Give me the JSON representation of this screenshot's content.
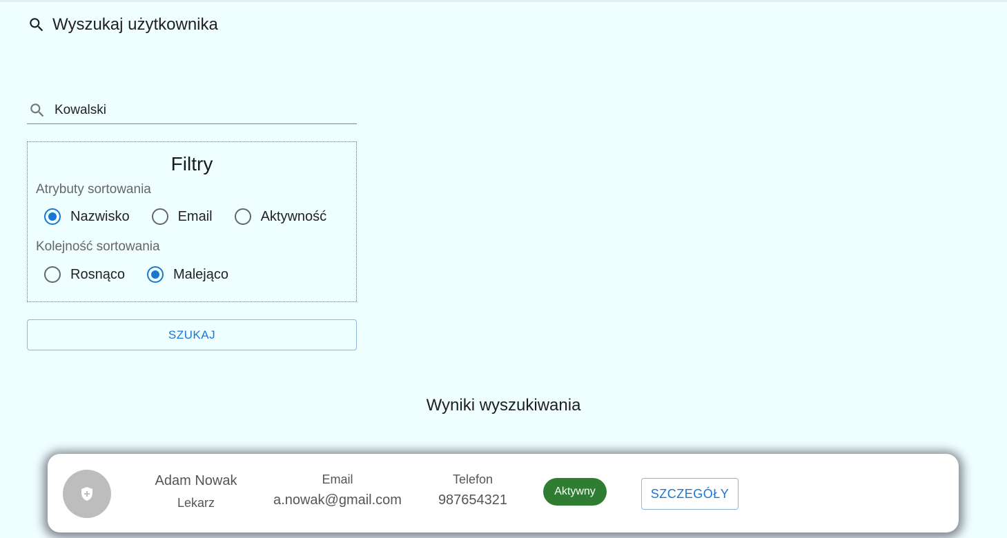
{
  "header": {
    "title": "Wyszukaj użytkownika",
    "icon": "search-icon"
  },
  "search": {
    "value": "Kowalski",
    "icon": "search-icon"
  },
  "filters": {
    "title": "Filtry",
    "sort_attributes": {
      "label": "Atrybuty sortowania",
      "options": [
        "Nazwisko",
        "Email",
        "Aktywność"
      ],
      "selected": "Nazwisko"
    },
    "sort_order": {
      "label": "Kolejność sortowania",
      "options": [
        "Rosnąco",
        "Malejąco"
      ],
      "selected": "Malejąco"
    }
  },
  "search_button": {
    "label": "SZUKAJ"
  },
  "results": {
    "title": "Wyniki wyszukiwania",
    "items": [
      {
        "name": "Adam Nowak",
        "role": "Lekarz",
        "email_label": "Email",
        "email": "a.nowak@gmail.com",
        "phone_label": "Telefon",
        "phone": "987654321",
        "status": "Aktywny",
        "details_label": "SZCZEGÓŁY",
        "avatar_icon": "medical-shield-icon"
      }
    ]
  },
  "colors": {
    "background": "#effefe",
    "accent": "#1976d2",
    "status_active": "#2e7d32",
    "avatar_bg": "#bdbdbd"
  }
}
